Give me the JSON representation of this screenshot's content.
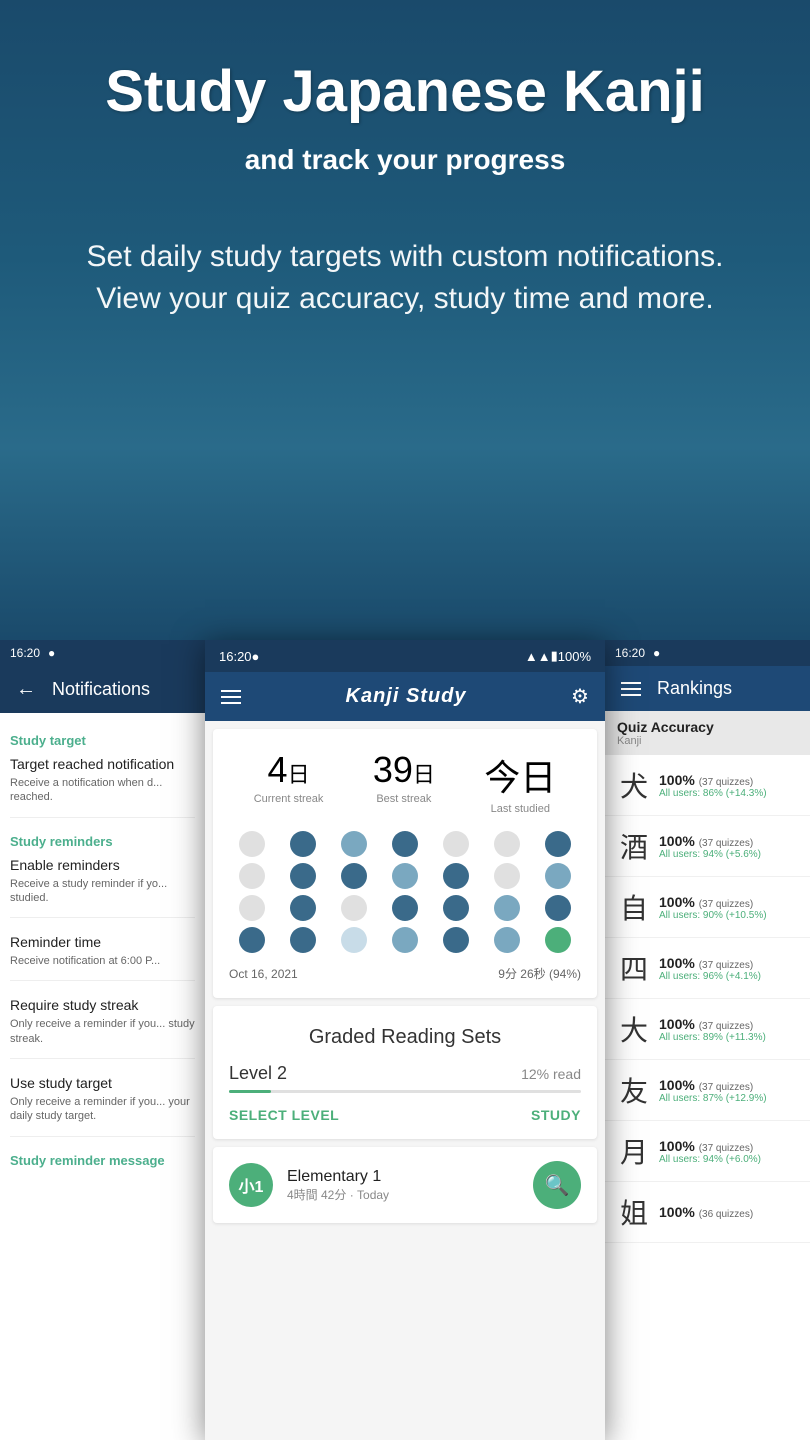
{
  "hero": {
    "title": "Study Japanese Kanji",
    "subtitle": "and track your progress",
    "description": "Set daily study targets with custom notifications. View your quiz accuracy, study time and more."
  },
  "left_panel": {
    "status_bar": {
      "time": "16:20",
      "icon": "●"
    },
    "header": {
      "back_label": "←",
      "title": "Notifications"
    },
    "sections": [
      {
        "header": "Study target",
        "items": [
          {
            "title": "Target reached notification",
            "desc": "Receive a notification when d... reached."
          }
        ]
      },
      {
        "header": "Study reminders",
        "items": [
          {
            "title": "Enable reminders",
            "desc": "Receive a study reminder if yo... studied."
          },
          {
            "title": "Reminder time",
            "desc": "Receive notification at 6:00 P..."
          },
          {
            "title": "Require study streak",
            "desc": "Only receive a reminder if you... study streak."
          },
          {
            "title": "Use study target",
            "desc": "Only receive a reminder if you... your daily study target."
          }
        ]
      },
      {
        "header": "Study reminder message",
        "items": []
      }
    ]
  },
  "center_panel": {
    "status_bar": {
      "time": "16:20",
      "icon": "●",
      "wifi": "▲▲",
      "battery": "100%"
    },
    "header": {
      "logo": "Kanji Study",
      "settings_icon": "⚙"
    },
    "streak": {
      "current_streak_number": "4",
      "current_streak_kanji": "日",
      "current_streak_label": "Current streak",
      "best_streak_number": "39",
      "best_streak_kanji": "日",
      "best_streak_label": "Best streak",
      "last_studied_label": "今日",
      "last_studied_sublabel": "Last studied",
      "date": "Oct 16, 2021",
      "time_studied": "9分 26秒 (94%)",
      "dots": [
        [
          "empty",
          "dark",
          "medium",
          "dark",
          "empty",
          "empty",
          "dark"
        ],
        [
          "empty",
          "dark",
          "dark",
          "medium",
          "dark",
          "empty",
          "medium"
        ],
        [
          "empty",
          "dark",
          "empty",
          "dark",
          "dark",
          "medium",
          "dark"
        ],
        [
          "dark",
          "dark",
          "light",
          "medium",
          "dark",
          "medium",
          "green"
        ]
      ]
    },
    "graded_reading": {
      "title": "Graded Reading Sets",
      "level": "Level 2",
      "percent": "12% read",
      "progress": 12,
      "select_label": "SELECT LEVEL",
      "study_label": "STUDY"
    },
    "elementary": {
      "avatar": "小1",
      "title": "Elementary 1",
      "subtitle": "4時間 42分 · Today",
      "search_icon": "🔍"
    }
  },
  "right_panel": {
    "status_bar": {
      "time": "16:20",
      "icon": "●"
    },
    "header": {
      "title": "Rankings"
    },
    "section": {
      "title": "Quiz Accuracy",
      "subtitle": "Kanji"
    },
    "rows": [
      {
        "kanji": "犬",
        "percent": "100%",
        "quizzes": "(37 quizzes)",
        "all_users": "All users: 86% (+14.3%)"
      },
      {
        "kanji": "酒",
        "percent": "100%",
        "quizzes": "(37 quizzes)",
        "all_users": "All users: 94% (+5.6%)"
      },
      {
        "kanji": "自",
        "percent": "100%",
        "quizzes": "(37 quizzes)",
        "all_users": "All users: 90% (+10.5%)"
      },
      {
        "kanji": "四",
        "percent": "100%",
        "quizzes": "(37 quizzes)",
        "all_users": "All users: 96% (+4.1%)"
      },
      {
        "kanji": "大",
        "percent": "100%",
        "quizzes": "(37 quizzes)",
        "all_users": "All users: 89% (+11.3%)"
      },
      {
        "kanji": "友",
        "percent": "100%",
        "quizzes": "(37 quizzes)",
        "all_users": "All users: 87% (+12.9%)"
      },
      {
        "kanji": "月",
        "percent": "100%",
        "quizzes": "(37 quizzes)",
        "all_users": "All users: 94% (+6.0%)"
      },
      {
        "kanji": "姐",
        "percent": "100%",
        "quizzes": "(36 quizzes)",
        "all_users": ""
      }
    ]
  },
  "colors": {
    "teal": "#4caf7a",
    "dark_blue": "#1a3a5c",
    "medium_blue": "#1e4976",
    "hero_bg": "#1a4a6b"
  }
}
